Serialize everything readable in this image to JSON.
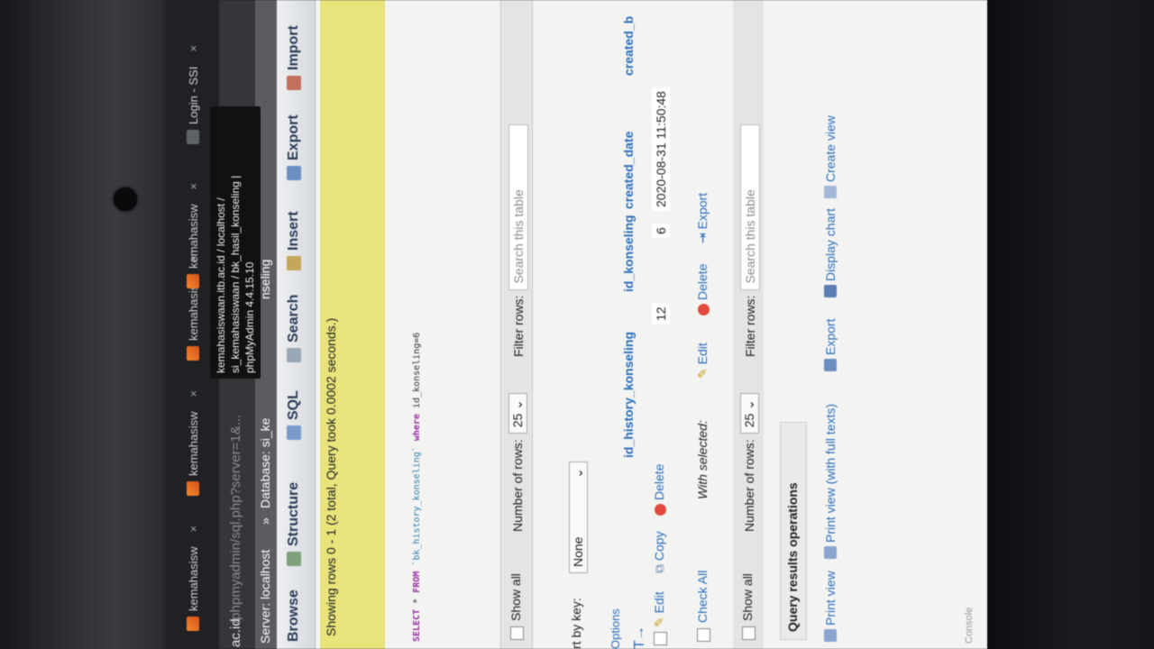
{
  "browser": {
    "tabs": [
      {
        "label": "kemahasisw",
        "close": "×"
      },
      {
        "label": "kemahasisw",
        "close": "×"
      },
      {
        "label": "kemahasisw",
        "close": "×"
      },
      {
        "label": "kemahasisw",
        "close": "×"
      },
      {
        "label": "Login - SSI",
        "close": "×"
      }
    ],
    "address": {
      "host": "ac.id",
      "path": "/phpmyadmin/sql.php?server=1&..."
    },
    "tooltip": {
      "line1": "kemahasiswaan.itb.ac.id / localhost /",
      "line2": "si_kemahasiswaan / bk_hasil_konseling |",
      "line3": "phpMyAdmin 4.4.15.10"
    }
  },
  "breadcrumb": {
    "server": "Server: localhost",
    "sep": "»",
    "database": "Database: si_ke",
    "table": "nseling"
  },
  "menu": [
    {
      "label": "Browse"
    },
    {
      "label": "Structure"
    },
    {
      "label": "SQL"
    },
    {
      "label": "Search"
    },
    {
      "label": "Insert"
    },
    {
      "label": "Export"
    },
    {
      "label": "Import"
    }
  ],
  "result": {
    "message": "Showing rows 0 - 1 (2 total, Query took 0.0002 seconds.)",
    "sql": {
      "select": "SELECT",
      "star": "*",
      "from": "FROM",
      "table": "`bk_history_konseling`",
      "where": "where",
      "cond": "id_konseling=6"
    }
  },
  "nav": {
    "show_all": "Show all",
    "rows_label": "Number of rows:",
    "rows_value": "25",
    "filter_label": "Filter rows:",
    "filter_placeholder": "Search this table"
  },
  "sort": {
    "label": "rt by key:",
    "value": "None"
  },
  "table": {
    "options_label": "Options",
    "columns": [
      "id_history_konseling",
      "id_konseling",
      "created_date",
      "created_b"
    ],
    "row_actions": {
      "edit": "Edit",
      "copy": "Copy",
      "delete": "Delete"
    },
    "rows": [
      {
        "id_history_konseling": "12",
        "id_konseling": "6",
        "created_date": "2020-08-31 11:50:48"
      }
    ]
  },
  "with_selected": {
    "check_all": "Check All",
    "label": "With selected:",
    "edit": "Edit",
    "delete": "Delete",
    "export": "Export"
  },
  "nav2": {
    "show_all": "Show all",
    "rows_label": "Number of rows:",
    "rows_value": "25",
    "filter_label": "Filter rows:",
    "filter_placeholder": "Search this table"
  },
  "query_ops": {
    "title": "Query results operations",
    "links": [
      "Print view",
      "Print view (with full texts)",
      "Export",
      "Display chart",
      "Create view"
    ]
  },
  "footer": {
    "brand": "Console"
  }
}
